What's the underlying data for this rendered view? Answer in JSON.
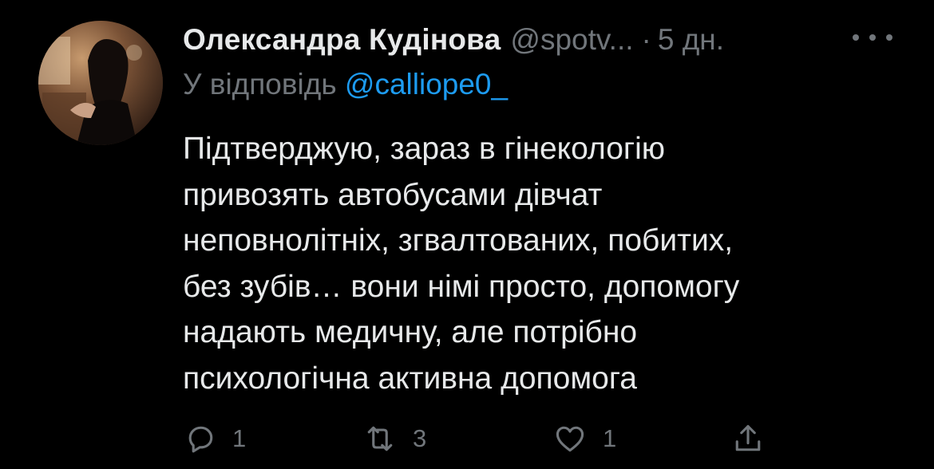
{
  "tweet": {
    "author_name": "Олександра Кудінова",
    "author_handle": "@spotv...",
    "separator": "·",
    "timestamp": "5 дн.",
    "reply_prefix": "У відповідь",
    "reply_mention": "@calliope0_",
    "text_lines": [
      "Підтверджую, зараз в гінекологію",
      "привозять автобусами дівчат",
      "неповнолітніх, згвалтованих, побитих,",
      "без зубів… вони німі просто, допомогу",
      "надають медичну, але потрібно",
      "психологічна активна допомога"
    ]
  },
  "actions": {
    "reply": {
      "icon": "reply-icon",
      "count": "1"
    },
    "retweet": {
      "icon": "retweet-icon",
      "count": "3"
    },
    "like": {
      "icon": "heart-icon",
      "count": "1"
    },
    "share": {
      "icon": "share-icon"
    }
  },
  "colors": {
    "background": "#000000",
    "text_primary": "#e7e9ea",
    "text_secondary": "#71767b",
    "accent": "#1d9bf0"
  }
}
